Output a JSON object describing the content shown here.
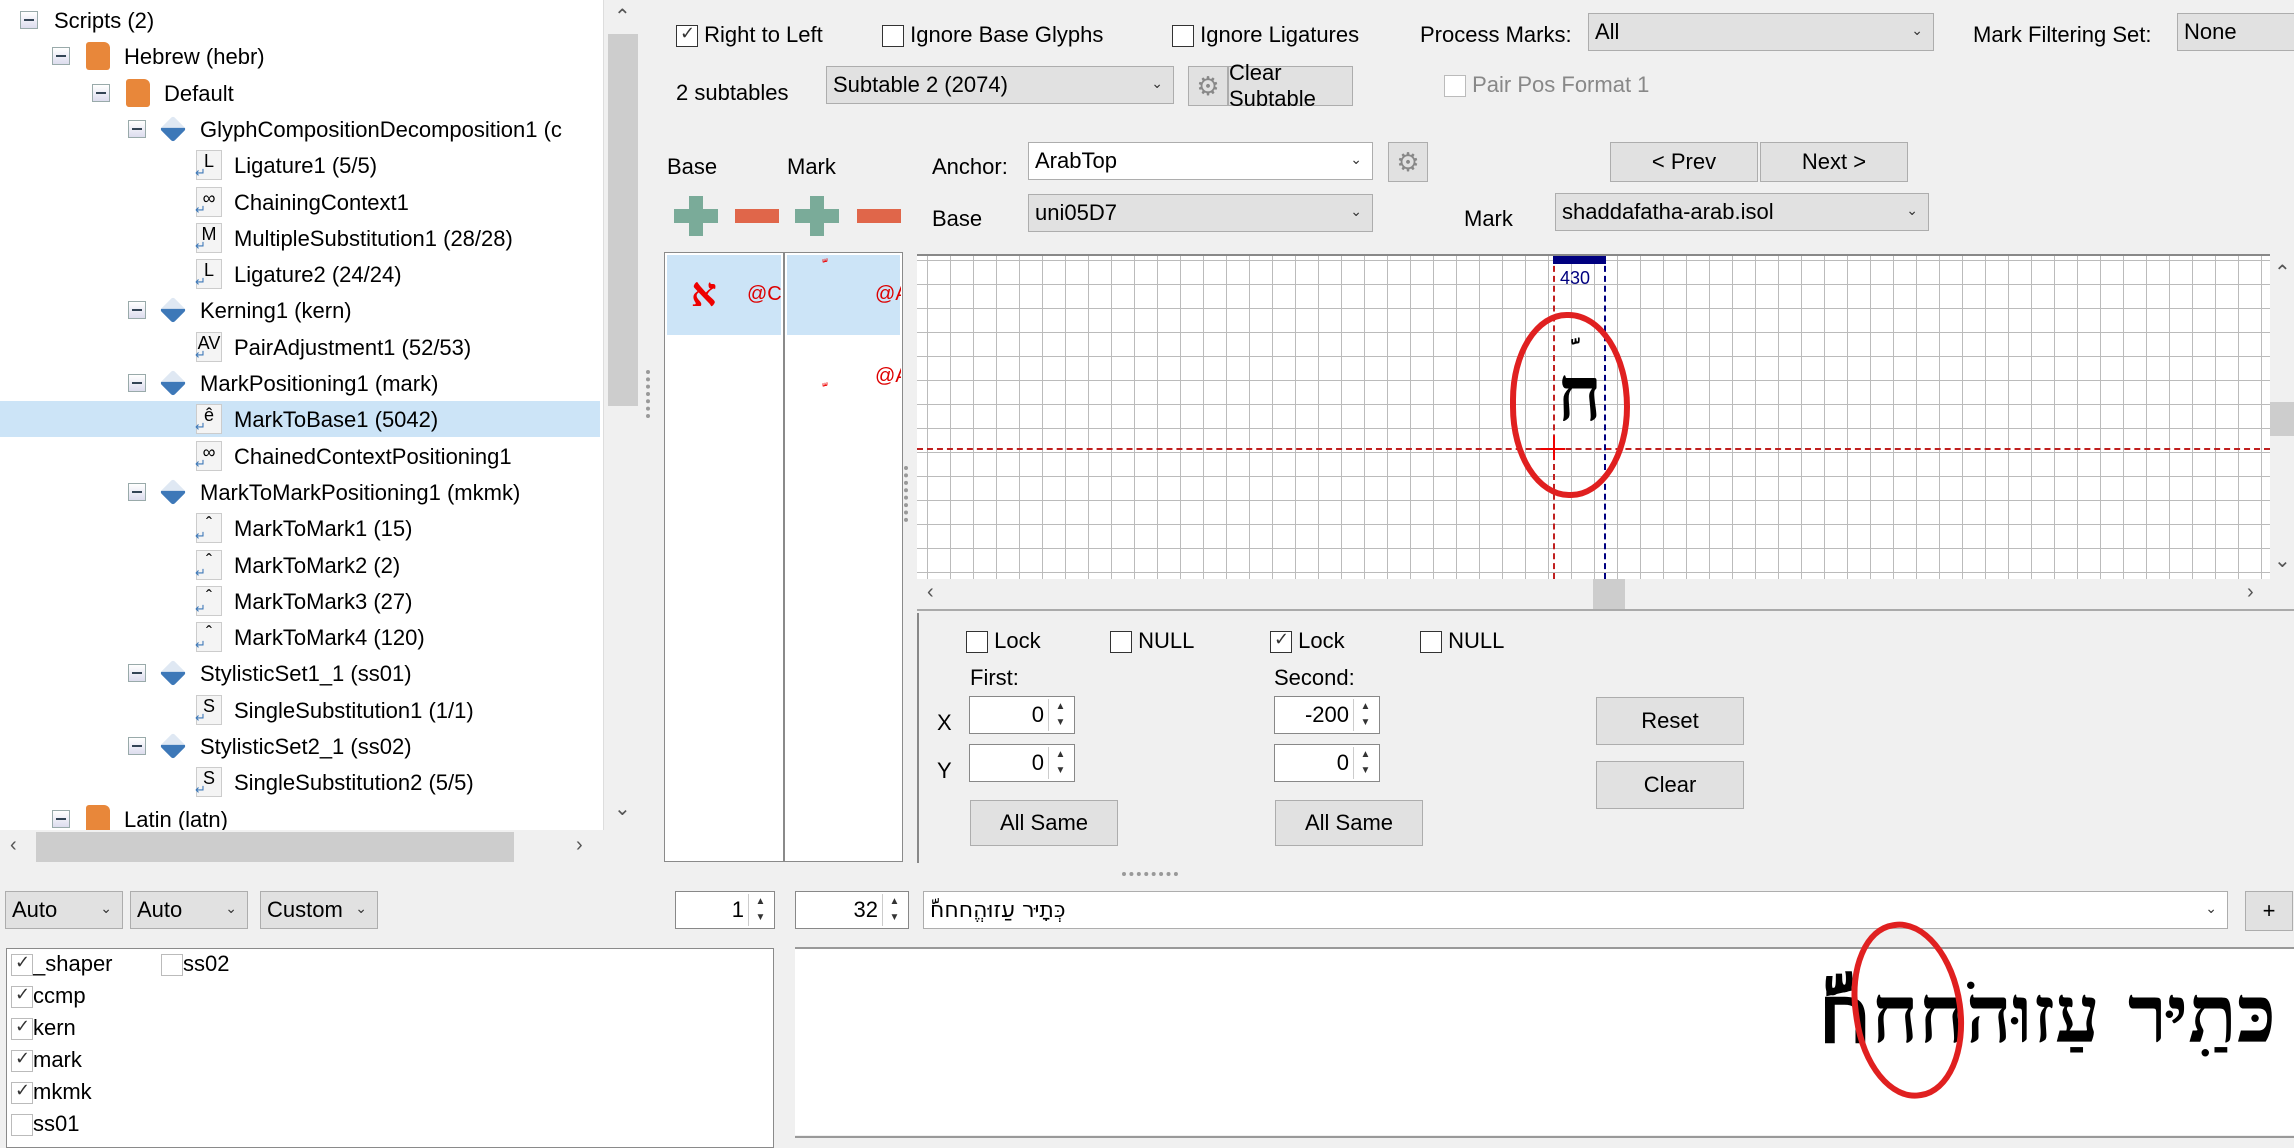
{
  "tree": {
    "nodes": [
      {
        "label": "Scripts (2)",
        "icon": "none"
      },
      {
        "label": "Hebrew (hebr)",
        "icon": "script-scroll-icon"
      },
      {
        "label": "Default",
        "icon": "language-system-icon"
      },
      {
        "label": "GlyphCompositionDecomposition1 (c",
        "icon": "feature-icon"
      },
      {
        "label": "Ligature1 (5/5)",
        "icon": "ligature-lookup-icon",
        "glyph": "L"
      },
      {
        "label": "ChainingContext1",
        "icon": "chaining-lookup-icon",
        "glyph": "∞"
      },
      {
        "label": "MultipleSubstitution1 (28/28)",
        "icon": "multiple-lookup-icon",
        "glyph": "M"
      },
      {
        "label": "Ligature2 (24/24)",
        "icon": "ligature-lookup-icon",
        "glyph": "L"
      },
      {
        "label": "Kerning1 (kern)",
        "icon": "feature-icon"
      },
      {
        "label": "PairAdjustment1 (52/53)",
        "icon": "pair-adjust-lookup-icon",
        "glyph": "AV"
      },
      {
        "label": "MarkPositioning1 (mark)",
        "icon": "feature-icon"
      },
      {
        "label": "MarkToBase1 (5042)",
        "icon": "mark-to-base-lookup-icon",
        "glyph": "ê",
        "selected": true
      },
      {
        "label": "ChainedContextPositioning1",
        "icon": "chaining-lookup-icon",
        "glyph": "∞"
      },
      {
        "label": "MarkToMarkPositioning1 (mkmk)",
        "icon": "feature-icon"
      },
      {
        "label": "MarkToMark1 (15)",
        "icon": "mark-to-mark-lookup-icon",
        "glyph": "ˆ"
      },
      {
        "label": "MarkToMark2 (2)",
        "icon": "mark-to-mark-lookup-icon",
        "glyph": "ˆ"
      },
      {
        "label": "MarkToMark3 (27)",
        "icon": "mark-to-mark-lookup-icon",
        "glyph": "ˆ"
      },
      {
        "label": "MarkToMark4 (120)",
        "icon": "mark-to-mark-lookup-icon",
        "glyph": "ˆ"
      },
      {
        "label": "StylisticSet1_1 (ss01)",
        "icon": "feature-icon"
      },
      {
        "label": "SingleSubstitution1 (1/1)",
        "icon": "single-lookup-icon",
        "glyph": "S"
      },
      {
        "label": "StylisticSet2_1 (ss02)",
        "icon": "feature-icon"
      },
      {
        "label": "SingleSubstitution2 (5/5)",
        "icon": "single-lookup-icon",
        "glyph": "S"
      },
      {
        "label": "Latin (latn)",
        "icon": "script-scroll-icon"
      }
    ]
  },
  "lookup_flags": {
    "right_to_left": {
      "label": "Right to Left",
      "checked": true
    },
    "ignore_base_glyphs": {
      "label": "Ignore Base Glyphs",
      "checked": false
    },
    "ignore_ligatures": {
      "label": "Ignore Ligatures",
      "checked": false
    },
    "process_marks_label": "Process Marks:",
    "process_marks_value": "All",
    "mark_filtering_label": "Mark Filtering Set:",
    "mark_filtering_value": "None"
  },
  "subtables": {
    "count_label": "2 subtables",
    "selected": "Subtable 2 (2074)",
    "clear_label": "Clear Subtable",
    "pair_pos_format_label": "Pair Pos Format 1"
  },
  "anchor_editor": {
    "base_col_label": "Base",
    "mark_col_label": "Mark",
    "anchor_label": "Anchor:",
    "anchor_value": "ArabTop",
    "base_label": "Base",
    "base_value": "uni05D7",
    "mark_label": "Mark",
    "mark_value": "shaddafatha-arab.isol",
    "prev_label": "< Prev",
    "next_label": "Next >"
  },
  "base_list": [
    {
      "glyph": "א",
      "anchor": "@C"
    }
  ],
  "mark_list": [
    {
      "glyph": "َّ",
      "anchor": "@A"
    },
    {
      "glyph": "َّ",
      "anchor": "@A"
    }
  ],
  "canvas": {
    "advance_width": "430",
    "base_glyph": "ח",
    "mark_glyph": "َّ"
  },
  "positioning": {
    "first": {
      "lock_label": "Lock",
      "lock": false,
      "null_label": "NULL",
      "null": false,
      "title": "First:",
      "x": "0",
      "y": "0",
      "all_same": "All Same"
    },
    "second": {
      "lock_label": "Lock",
      "lock": true,
      "null_label": "NULL",
      "null": false,
      "title": "Second:",
      "x": "-200",
      "y": "0",
      "all_same": "All Same"
    },
    "x_label": "X",
    "y_label": "Y",
    "reset_label": "Reset",
    "clear_label": "Clear"
  },
  "preview": {
    "script_combo": "Auto",
    "lang_combo": "Auto",
    "mode_combo": "Custom",
    "spin1": "1",
    "font_size": "32",
    "text": "כְּתָיּר עַזוּהֱחחחَّ",
    "rendered_text": "כּתִַיּר עַזוּהֹחחחَّ",
    "add_label": "+",
    "features": [
      {
        "tag": "_shaper",
        "checked": true
      },
      {
        "tag": "ss02",
        "checked": false
      },
      {
        "tag": "ccmp",
        "checked": true
      },
      {
        "tag": "kern",
        "checked": true
      },
      {
        "tag": "mark",
        "checked": true
      },
      {
        "tag": "mkmk",
        "checked": true
      },
      {
        "tag": "ss01",
        "checked": false
      }
    ]
  },
  "colors": {
    "selection": "#cce4f7",
    "add_green": "#7aab99",
    "remove_orange": "#e0664a",
    "annotation_red": "#e02020",
    "advance_bar": "#00007f"
  }
}
